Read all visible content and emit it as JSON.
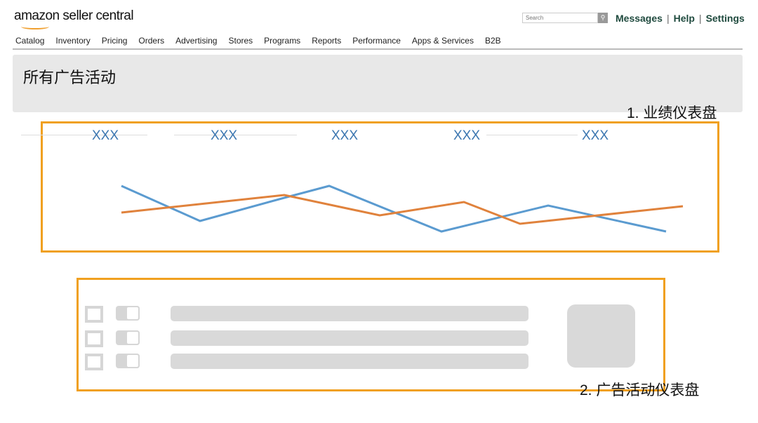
{
  "header": {
    "logo": "amazon seller central",
    "search_placeholder": "Search",
    "links": [
      "Messages",
      "Help",
      "Settings"
    ]
  },
  "nav": [
    "Catalog",
    "Inventory",
    "Pricing",
    "Orders",
    "Advertising",
    "Stores",
    "Programs",
    "Reports",
    "Performance",
    "Apps & Services",
    "B2B"
  ],
  "page_title": "所有广告活动",
  "section1": {
    "label": "1. 业绩仪表盘",
    "metrics": [
      "XXX",
      "XXX",
      "XXX",
      "XXX",
      "XXX"
    ]
  },
  "section2": {
    "label": "2. 广告活动仪表盘",
    "rows": 3
  },
  "colors": {
    "accent": "#f0a020",
    "blue": "#5b9bd0",
    "orange": "#e0823c"
  },
  "chart_data": {
    "type": "line",
    "series": [
      {
        "color": "#5b9bd0",
        "x": [
          0,
          1.4,
          2.9,
          3.7,
          5.7,
          7.6,
          9.7
        ],
        "y": [
          75,
          25,
          58,
          75,
          10,
          47,
          10
        ]
      },
      {
        "color": "#e0823c",
        "x": [
          0,
          2.9,
          4.6,
          6.1,
          7.1,
          10
        ],
        "y": [
          37,
          62,
          33,
          52,
          21,
          46
        ]
      }
    ]
  }
}
